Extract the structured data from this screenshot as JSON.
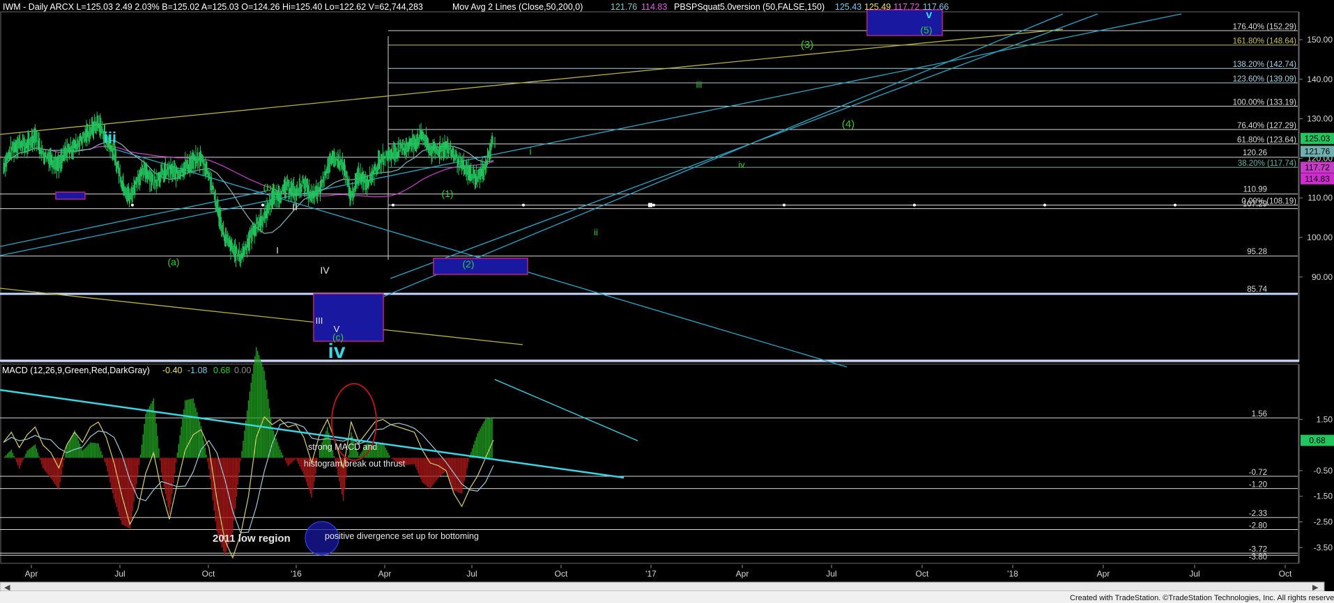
{
  "header": {
    "symbol_line": "IWM - Daily  ARCX  L=125.03  2.49  2.03%  B=125.02  A=125.03  O=124.26  Hi=125.40  Lo=122.62  V=62,744,283",
    "mov_avg": "Mov Avg 2 Lines (Close,50,200,0)",
    "mov_avg_vals": [
      "121.76",
      "114.83"
    ],
    "pbsp": "PBSPSquat5.0version (50,FALSE,150)",
    "pbsp_vals": [
      "125.43",
      "125.49",
      "117.72",
      "117.66"
    ]
  },
  "macd_header": {
    "label": "MACD (12,26,9,Green,Red,DarkGray)",
    "vals": [
      "-0.40",
      "-1.08",
      "0.68",
      "0.00"
    ]
  },
  "footer": {
    "credit": "Created with TradeStation. ©TradeStation Technologies, Inc. All rights reserved."
  },
  "colors": {
    "price": "#22c55e",
    "ma50": "#7fb8b8",
    "ma200": "#d040d0",
    "fib": "#d9d9d9",
    "channel": "#2aa9c9",
    "trend": "#b8b33a",
    "wave_green": "#33cc33",
    "wave_cyan": "#3ad6e6",
    "macd_line": "#d9cf6e",
    "macd_signal": "#9fc8d8",
    "hist_pos": "#1fa01f",
    "hist_neg": "#b01818",
    "box": "#1818a0",
    "box_border": "#c02080"
  },
  "chart_data": [
    {
      "type": "line",
      "name": "price-panel",
      "x_ticks": [
        "Apr",
        "Jul",
        "Oct",
        "'16",
        "Apr",
        "Jul",
        "Oct",
        "'17",
        "Apr",
        "Jul",
        "Oct",
        "'18",
        "Apr",
        "Jul",
        "Oct"
      ],
      "y_ticks": [
        90,
        100,
        110,
        120,
        130,
        140,
        150
      ],
      "ylim": [
        82,
        156
      ],
      "series": [
        {
          "values": [
            118,
            122,
            124,
            123,
            126,
            121,
            120,
            118,
            122,
            123,
            125,
            127,
            129,
            125,
            121,
            114,
            110,
            115,
            117,
            114,
            116,
            117,
            116,
            118,
            119,
            120,
            116,
            108,
            100,
            97,
            95,
            99,
            103,
            105,
            110,
            111,
            113,
            111,
            114,
            110,
            112,
            118,
            120,
            118,
            110,
            116,
            114,
            117,
            120,
            121,
            122,
            123,
            124,
            126,
            122,
            122,
            123,
            121,
            118,
            116,
            115,
            118,
            125
          ]
        }
      ],
      "fib_levels": [
        {
          "pct": "176.40%",
          "value": 152.29
        },
        {
          "pct": "161.80%",
          "value": 148.64
        },
        {
          "pct": "138.20%",
          "value": 142.74
        },
        {
          "pct": "123.60%",
          "value": 139.09
        },
        {
          "pct": "100.00%",
          "value": 133.19
        },
        {
          "pct": "76.40%",
          "value": 127.29
        },
        {
          "pct": "61.80%",
          "value": 123.64
        },
        {
          "pct": "38.20%",
          "value": 117.74
        },
        {
          "pct": "0.00%",
          "value": 108.19
        }
      ],
      "levels": [
        120.26,
        110.99,
        107.29,
        95.28,
        85.74
      ],
      "badges": [
        {
          "text": "125.03",
          "value": 125.03,
          "color": "#22c55e",
          "fg": "#000"
        },
        {
          "text": "121.76",
          "value": 121.76,
          "color": "#6fb0b0",
          "fg": "#000"
        },
        {
          "text": "117.72",
          "value": 117.72,
          "color": "#c83ac8",
          "fg": "#000"
        },
        {
          "text": "114.83",
          "value": 114.83,
          "color": "#d02ad0",
          "fg": "#000"
        }
      ],
      "wave_labels": [
        {
          "text": "iii",
          "color": "cyan",
          "big": true
        },
        {
          "text": "(5)",
          "color": "green"
        },
        {
          "text": "(b)",
          "color": "green"
        },
        {
          "text": "(a)",
          "color": "green"
        },
        {
          "text": "II",
          "color": "white"
        },
        {
          "text": "I",
          "color": "white"
        },
        {
          "text": "IV",
          "color": "white"
        },
        {
          "text": "III",
          "color": "white"
        },
        {
          "text": "V",
          "color": "white"
        },
        {
          "text": "(c)",
          "color": "green"
        },
        {
          "text": "iv",
          "color": "cyan",
          "big": true
        },
        {
          "text": "(1)",
          "color": "green"
        },
        {
          "text": "(2)",
          "color": "green"
        },
        {
          "text": "i",
          "color": "green"
        },
        {
          "text": "ii",
          "color": "green"
        },
        {
          "text": "iii",
          "color": "green"
        },
        {
          "text": "iv",
          "color": "green"
        },
        {
          "text": "(3)",
          "color": "green"
        },
        {
          "text": "(4)",
          "color": "green"
        },
        {
          "text": "(5)",
          "color": "green"
        },
        {
          "text": "v",
          "color": "cyan"
        }
      ]
    },
    {
      "type": "line",
      "name": "macd-panel",
      "y_ticks": [
        1.5,
        -0.5,
        -1.5,
        -2.5,
        -3.5
      ],
      "ylim": [
        -4.1,
        2.0
      ],
      "levels": [
        1.56,
        -0.72,
        -1.2,
        -2.33,
        -2.8,
        -3.72,
        -3.8
      ],
      "level_labels": [
        "1.56",
        "-0.72",
        "-1.20",
        "-2.33",
        "-2.80",
        "-3.72",
        "-3.80"
      ],
      "badge": {
        "text": "0.68",
        "value": 0.68
      },
      "macd": [
        0.6,
        1.0,
        0.4,
        0.9,
        1.2,
        0.5,
        0.2,
        -0.4,
        0.5,
        1.0,
        0.6,
        1.2,
        1.4,
        0.8,
        -0.2,
        -1.5,
        -2.6,
        -2.0,
        -0.6,
        0.2,
        -1.3,
        -2.4,
        -1.0,
        0.3,
        0.9,
        1.1,
        0.4,
        -1.6,
        -3.2,
        -3.9,
        -3.0,
        -1.5,
        0.8,
        1.6,
        1.3,
        1.5,
        1.2,
        1.3,
        0.8,
        -0.2,
        0.9,
        1.5,
        0.6,
        -0.4,
        1.4,
        0.6,
        1.0,
        1.4,
        1.5,
        1.3,
        1.2,
        1.1,
        1.0,
        0.3,
        -0.2,
        -0.3,
        -0.5,
        -1.4,
        -1.9,
        -1.2,
        -0.7,
        0.0,
        0.7
      ],
      "annotations": [
        "strong MACD  and",
        "histogram break out thrust",
        "2011 low region",
        "positive divergence set up for bottoming"
      ]
    }
  ]
}
